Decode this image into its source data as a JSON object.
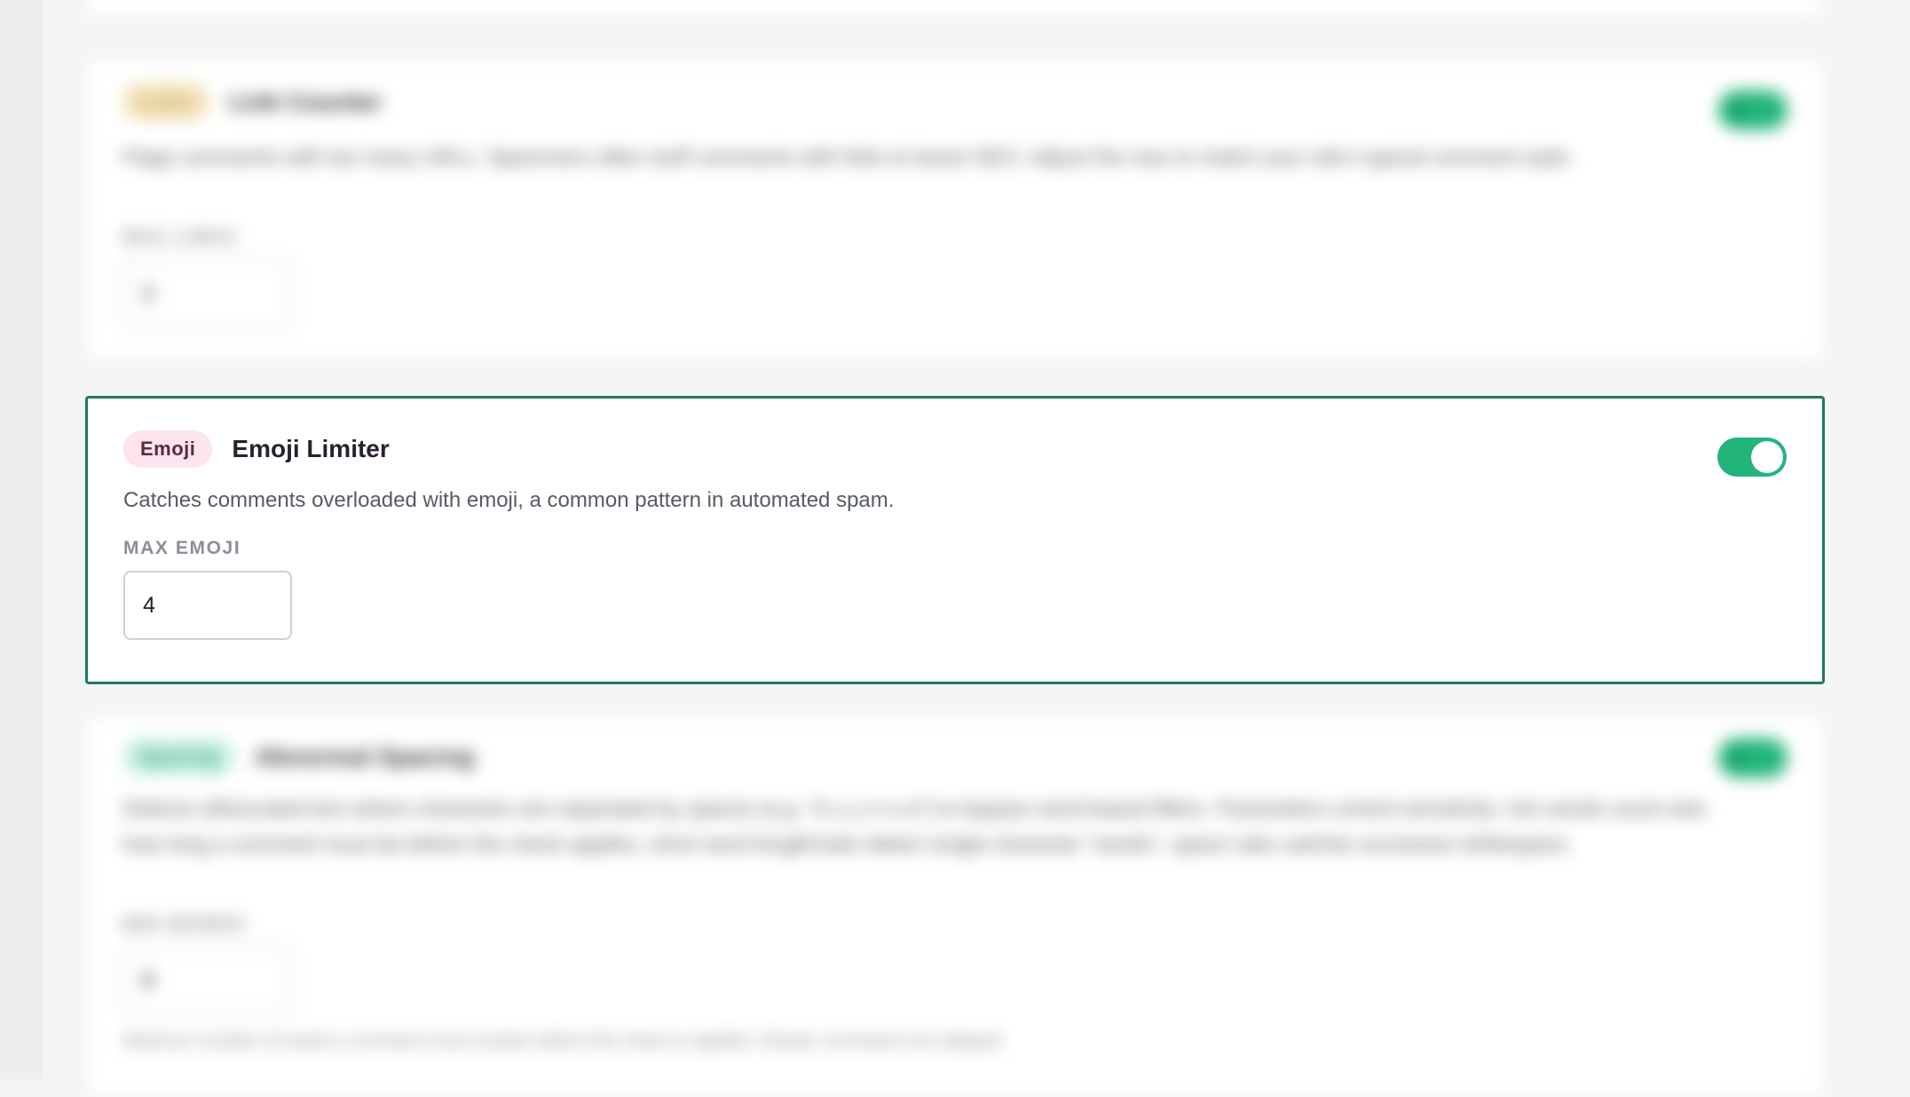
{
  "cards": [
    {
      "badge": "Links",
      "title": "Link Counter",
      "description": "Flags comments with too many URLs. Spammers often stuff comments with links to boost SEO. Adjust the max to match your site's typical comment style.",
      "field_label": "MAX LINKS",
      "value": "2",
      "enabled": true,
      "badge_color": "#f3e2b8"
    },
    {
      "badge": "Emoji",
      "title": "Emoji Limiter",
      "description": "Catches comments overloaded with emoji, a common pattern in automated spam.",
      "field_label": "MAX EMOJI",
      "value": "4",
      "enabled": true,
      "badge_color": "#fde4ef"
    },
    {
      "badge": "Spacing",
      "title": "Abnormal Spacing",
      "description": "Detects obfuscated text where characters are separated by spaces (e.g. \"b u y n o w\") to bypass word-based filters. Parameters control sensitivity: min words count sets how long a comment must be before the check applies, short word length/ratio detect single-character \"words\", space ratio catches excessive whitespace.",
      "field_label": "MIN WORDS",
      "value": "8",
      "hint": "Minimum number of words a comment must contain before this check is applied. Shorter comments are skipped.",
      "enabled": true,
      "badge_color": "#c8f1e2"
    }
  ],
  "colors": {
    "toggle_on": "#22b57a",
    "focus_border": "#1f7a5a"
  }
}
